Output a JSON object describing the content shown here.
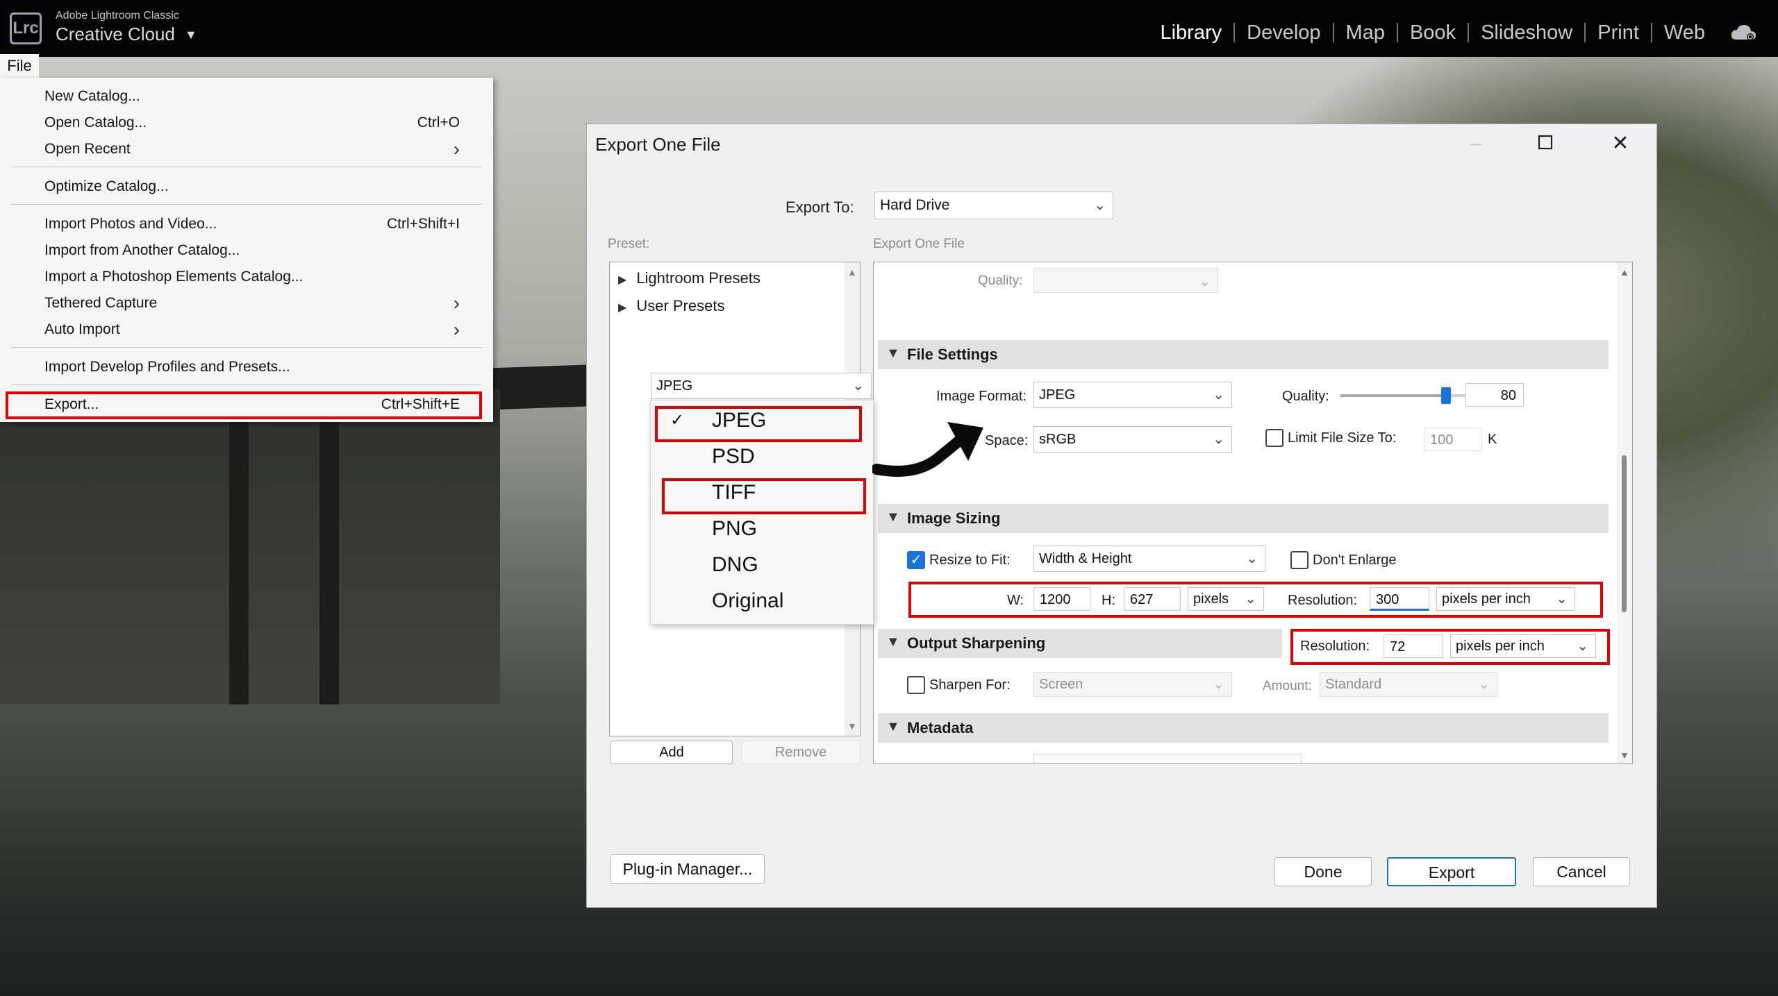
{
  "topbar": {
    "app_sub": "Adobe Lightroom Classic",
    "app_main": "Creative Cloud",
    "badge": "Lrc",
    "modules": [
      "Library",
      "Develop",
      "Map",
      "Book",
      "Slideshow",
      "Print",
      "Web"
    ]
  },
  "file_menu": {
    "tab": "File",
    "items": [
      {
        "label": "New Catalog...",
        "shortcut": ""
      },
      {
        "label": "Open Catalog...",
        "shortcut": "Ctrl+O"
      },
      {
        "label": "Open Recent",
        "shortcut": ""
      },
      {
        "label": "Optimize Catalog...",
        "shortcut": ""
      },
      {
        "label": "Import Photos and Video...",
        "shortcut": "Ctrl+Shift+I"
      },
      {
        "label": "Import from Another Catalog...",
        "shortcut": ""
      },
      {
        "label": "Import a Photoshop Elements Catalog...",
        "shortcut": ""
      },
      {
        "label": "Tethered Capture",
        "shortcut": ""
      },
      {
        "label": "Auto Import",
        "shortcut": ""
      },
      {
        "label": "Import Develop Profiles and Presets...",
        "shortcut": ""
      },
      {
        "label": "Export...",
        "shortcut": "Ctrl+Shift+E"
      }
    ]
  },
  "dialog": {
    "title": "Export One File",
    "export_to_label": "Export To:",
    "export_to_value": "Hard Drive",
    "preset_label": "Preset:",
    "settings_label": "Export One File",
    "presets": [
      "Lightroom Presets",
      "User Presets"
    ],
    "add_button": "Add",
    "remove_button": "Remove",
    "plugin_button": "Plug-in Manager...",
    "done_button": "Done",
    "export_button": "Export",
    "cancel_button": "Cancel",
    "quality_top_label": "Quality:",
    "file_settings": {
      "header": "File Settings",
      "image_format_label": "Image Format:",
      "image_format_value": "JPEG",
      "quality_label": "Quality:",
      "quality_value": "80",
      "quality_level": 0.8,
      "color_space_label": "Space:",
      "color_space_value": "sRGB",
      "limit_label": "Limit File Size To:",
      "limit_value": "100",
      "limit_unit": "K"
    },
    "format_dropdown": {
      "current": "JPEG",
      "options": [
        "JPEG",
        "PSD",
        "TIFF",
        "PNG",
        "DNG",
        "Original"
      ]
    },
    "image_sizing": {
      "header": "Image Sizing",
      "resize_label": "Resize to Fit:",
      "resize_value": "Width & Height",
      "dont_enlarge_label": "Don't Enlarge",
      "w_label": "W:",
      "w_value": "1200",
      "h_label": "H:",
      "h_value": "627",
      "unit_value": "pixels",
      "resolution_label": "Resolution:",
      "resolution_value": "300",
      "resolution_unit": "pixels per inch"
    },
    "output_sharpening": {
      "header": "Output Sharpening",
      "sharpen_label": "Sharpen For:",
      "sharpen_value": "Screen",
      "amount_label": "Amount:",
      "amount_value": "Standard",
      "resolution_label": "Resolution:",
      "resolution_value": "72",
      "resolution_unit": "pixels per inch"
    },
    "metadata": {
      "header": "Metadata"
    }
  },
  "colors": {
    "highlight_red": "#e00000",
    "accent_blue": "#1a73d8"
  }
}
